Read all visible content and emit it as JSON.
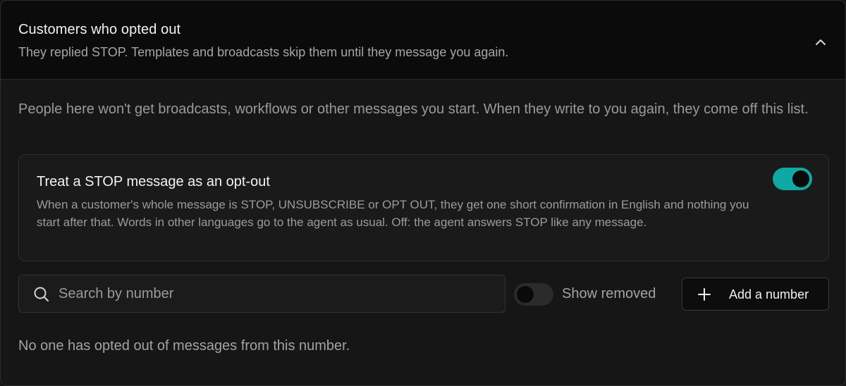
{
  "header": {
    "title": "Customers who opted out",
    "subtitle": "They replied STOP. Templates and broadcasts skip them until they message you again.",
    "collapse_icon": "chevron-up-icon"
  },
  "intro": "People here won't get broadcasts, workflows or other messages you start. When they write to you again, they come off this list.",
  "stop_setting": {
    "title": "Treat a STOP message as an opt-out",
    "description": "When a customer's whole message is STOP, UNSUBSCRIBE or OPT OUT, they get one short confirmation in English and nothing you start after that. Words in other languages go to the agent as usual. Off: the agent answers STOP like any message.",
    "enabled": true,
    "accent_color": "#10a8a3"
  },
  "search": {
    "placeholder": "Search by number",
    "value": "",
    "icon": "search-icon"
  },
  "show_removed": {
    "label": "Show removed",
    "enabled": false
  },
  "add_button": {
    "label": "Add a number",
    "icon": "plus-icon"
  },
  "empty_state": "No one has opted out of messages from this number."
}
